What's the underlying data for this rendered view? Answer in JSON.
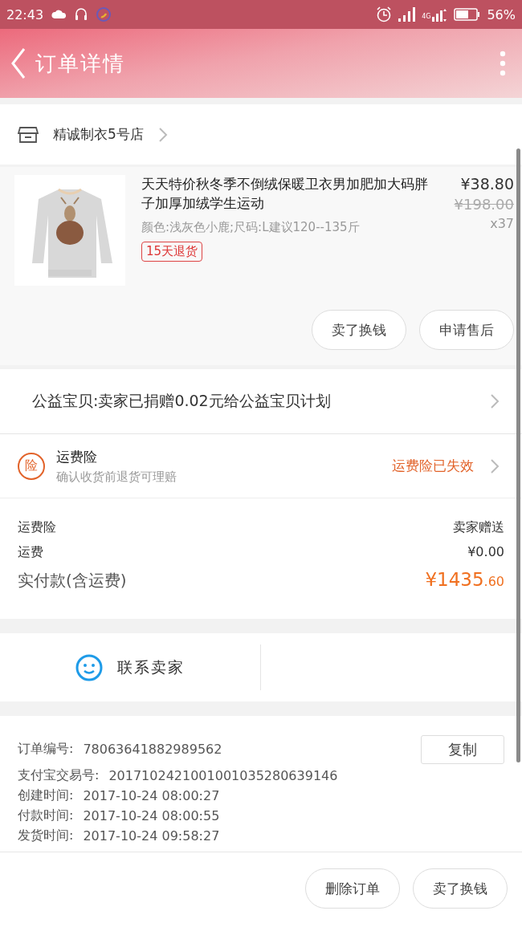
{
  "status_bar": {
    "time": "22:43",
    "network": "4G",
    "battery": "56%"
  },
  "header": {
    "title": "订单详情"
  },
  "shop": {
    "name": "精诚制衣5号店"
  },
  "product": {
    "title": "天天特价秋冬季不倒绒保暖卫衣男加肥加大码胖子加厚加绒学生运动",
    "spec": "颜色:浅灰色小鹿;尺码:L建议120--135斤",
    "price": "¥38.80",
    "original_price": "¥198.00",
    "quantity": "x37",
    "tag": "15天退货",
    "buttons": [
      "卖了换钱",
      "申请售后"
    ]
  },
  "charity": {
    "text": "公益宝贝:卖家已捐赠0.02元给公益宝贝计划"
  },
  "insurance": {
    "badge": "险",
    "title": "运费险",
    "subtitle": "确认收货前退货可理赔",
    "status": "运费险已失效"
  },
  "summary": [
    {
      "kind": "plain",
      "label": "运费险",
      "value": "卖家赠送"
    },
    {
      "kind": "plain",
      "label": "运费",
      "value": "¥0.00"
    },
    {
      "kind": "total",
      "label": "实付款(含运费)",
      "value": "¥1435",
      "fraction": ".60"
    }
  ],
  "contact": {
    "label": "联系卖家"
  },
  "order_info": {
    "copy_button": "复制",
    "rows": [
      {
        "label": "订单编号:",
        "value": "78063641882989562"
      },
      {
        "label": "支付宝交易号:",
        "value": "2017102421001001035280639146"
      },
      {
        "label": "创建时间:",
        "value": "2017-10-24 08:00:27"
      },
      {
        "label": "付款时间:",
        "value": "2017-10-24 08:00:55"
      },
      {
        "label": "发货时间:",
        "value": "2017-10-24 09:58:27"
      }
    ]
  },
  "footer": {
    "buttons": [
      "删除订单",
      "卖了换钱"
    ]
  }
}
